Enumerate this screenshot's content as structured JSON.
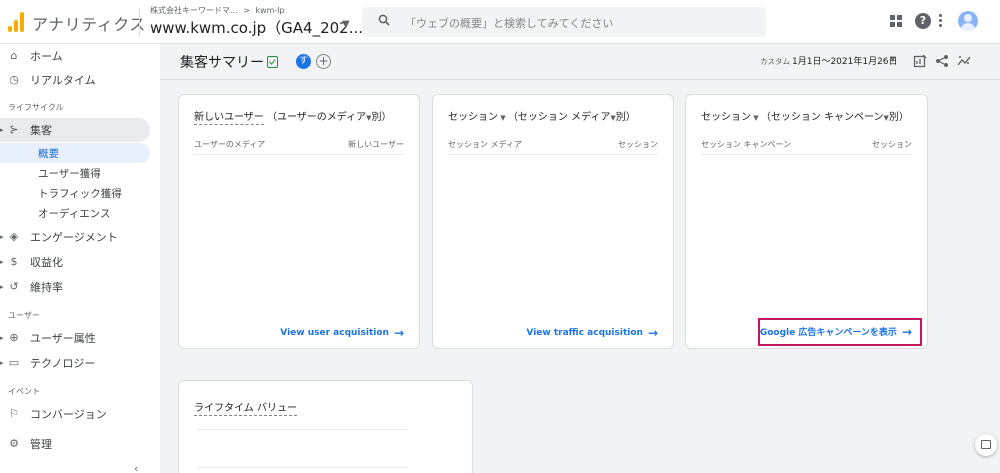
{
  "header": {
    "app_name": "アナリティクス",
    "account": "株式会社キーワードマ...",
    "breadcrumb_sep": ">",
    "stream": "kwm-lp",
    "property": "www.kwm.co.jp（GA4_202...",
    "search_placeholder": "「ウェブの概要」と検索してみてください"
  },
  "sidebar": {
    "home": "ホーム",
    "realtime": "リアルタイム",
    "lifecycle_header": "ライフサイクル",
    "acquisition": "集客",
    "acquisition_items": [
      "概要",
      "ユーザー獲得",
      "トラフィック獲得",
      "オーディエンス"
    ],
    "engagement": "エンゲージメント",
    "monetization": "収益化",
    "retention": "維持率",
    "user_header": "ユーザー",
    "user_attributes": "ユーザー属性",
    "technology": "テクノロジー",
    "event_header": "イベント",
    "conversions": "コンバージョン",
    "admin": "管理"
  },
  "toolbar": {
    "title": "集客サマリー",
    "user_chip": "す",
    "add_chip": "+",
    "date_label": "カスタム",
    "date_range": "1月1日～2021年1月26日"
  },
  "cards": [
    {
      "title_main": "新しいユーザー",
      "title_dim": "（ユーザーのメディア",
      "title_tail": "別）",
      "col_left": "ユーザーのメディア",
      "col_right": "新しいユーザー",
      "link": "View user acquisition"
    },
    {
      "title_main": "セッション",
      "title_dim": "（セッション メディア",
      "title_tail": "別）",
      "col_left": "セッション メディア",
      "col_right": "セッション",
      "link": "View traffic acquisition"
    },
    {
      "title_main": "セッション",
      "title_dim": "（セッション キャンペーン",
      "title_tail": "別）",
      "col_left": "セッション キャンペーン",
      "col_right": "セッション",
      "link": "Google 広告キャンペーンを表示"
    },
    {
      "title_main": "ライフタイム バリュー"
    }
  ],
  "colors": {
    "accent": "#1a73e8",
    "highlight": "#c2185b",
    "logo": "#f9ab00"
  }
}
